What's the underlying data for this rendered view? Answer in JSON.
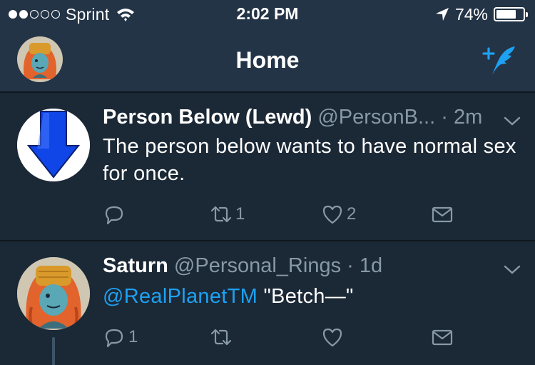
{
  "status_bar": {
    "carrier": "Sprint",
    "signal_bars_filled": 2,
    "signal_bars_total": 5,
    "time": "2:02 PM",
    "battery_percent_label": "74%",
    "battery_level": 0.74,
    "icons": [
      "wifi-icon",
      "location-arrow-icon",
      "battery-icon"
    ]
  },
  "nav": {
    "title": "Home",
    "profile_icon": "profile-avatar",
    "compose_icon": "compose-tweet-icon"
  },
  "colors": {
    "background": "#1b2836",
    "header": "#243447",
    "divider": "#10171e",
    "accent": "#1da1f2",
    "secondary_text": "#8899a6",
    "arrow_blue": "#1046e8"
  },
  "tweets": [
    {
      "display_name": "Person Below (Lewd)",
      "handle": "@PersonB...",
      "time": "· 2m",
      "text": "The person below wants to have normal sex for once.",
      "mention": "",
      "avatar_icon": "down-arrow-avatar",
      "actions": {
        "reply": "",
        "retweet": "1",
        "like": "2"
      }
    },
    {
      "display_name": "Saturn",
      "handle": "@Personal_Rings",
      "time": "· 1d",
      "mention": "@RealPlanetTM",
      "text": " \"Betch—\"",
      "avatar_icon": "character-avatar",
      "actions": {
        "reply": "1",
        "retweet": "",
        "like": ""
      }
    }
  ]
}
